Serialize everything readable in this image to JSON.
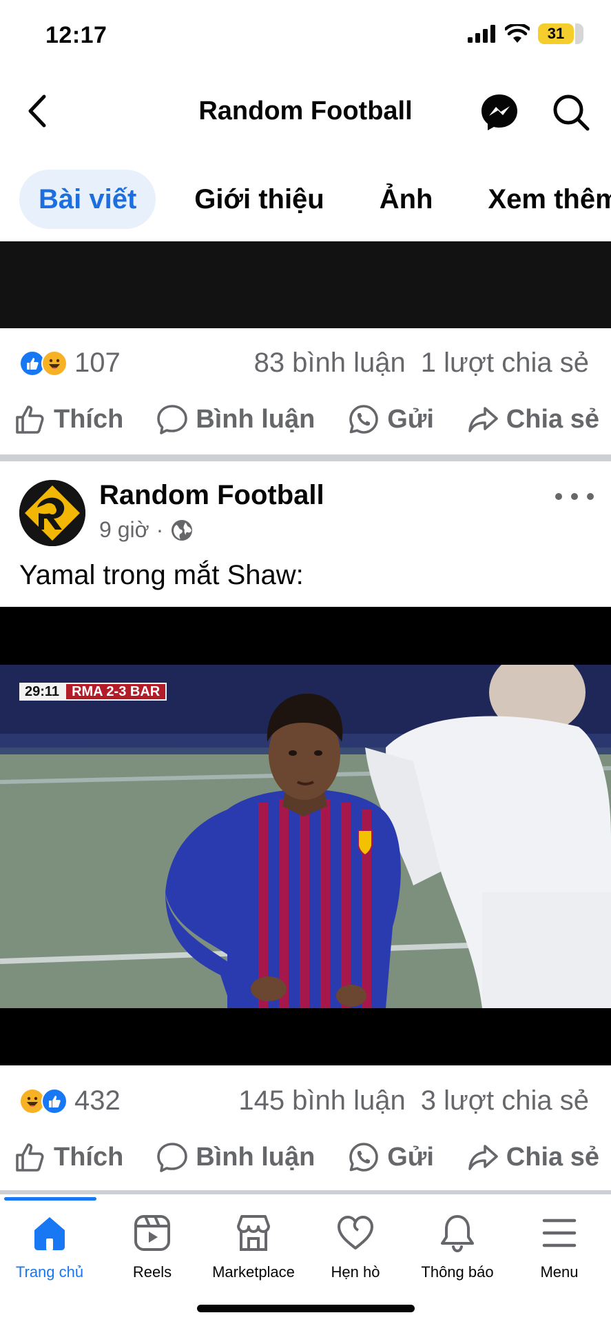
{
  "status_bar": {
    "time": "12:17",
    "battery": "31",
    "icons": [
      "signal-icon",
      "wifi-icon",
      "battery-icon"
    ]
  },
  "header": {
    "title": "Random Football",
    "back_icon": "chevron-left-icon",
    "messenger_icon": "messenger-icon",
    "search_icon": "search-icon"
  },
  "tabs": [
    {
      "label": "Bài viết",
      "active": true
    },
    {
      "label": "Giới thiệu",
      "active": false
    },
    {
      "label": "Ảnh",
      "active": false
    },
    {
      "label": "Xem thêm",
      "active": false
    }
  ],
  "post1": {
    "reaction_count": "107",
    "comments": "83 bình luận",
    "shares": "1 lượt chia sẻ",
    "reactions": [
      "like",
      "haha"
    ]
  },
  "actions": {
    "like": "Thích",
    "comment": "Bình luận",
    "send": "Gửi",
    "share": "Chia sẻ"
  },
  "post2": {
    "author": "Random Football",
    "time": "9 giờ",
    "separator": "·",
    "privacy_icon": "globe-icon",
    "text": "Yamal trong mắt Shaw:",
    "video": {
      "scoreboard_time": "29:11",
      "scoreboard_score": "RMA 2-3 BAR"
    },
    "reaction_count": "432",
    "comments": "145 bình luận",
    "shares": "3 lượt chia sẻ",
    "reactions": [
      "haha",
      "like"
    ]
  },
  "bottom_nav": [
    {
      "label": "Trang chủ",
      "icon": "home-icon",
      "active": true
    },
    {
      "label": "Reels",
      "icon": "reels-icon",
      "active": false
    },
    {
      "label": "Marketplace",
      "icon": "marketplace-icon",
      "active": false
    },
    {
      "label": "Hẹn hò",
      "icon": "dating-icon",
      "active": false
    },
    {
      "label": "Thông báo",
      "icon": "bell-icon",
      "active": false
    },
    {
      "label": "Menu",
      "icon": "menu-icon",
      "active": false
    }
  ],
  "colors": {
    "accent": "#1877f2",
    "tab_active_bg": "#e8f0fb",
    "muted_text": "#65676b",
    "battery": "#f5cd2c"
  }
}
